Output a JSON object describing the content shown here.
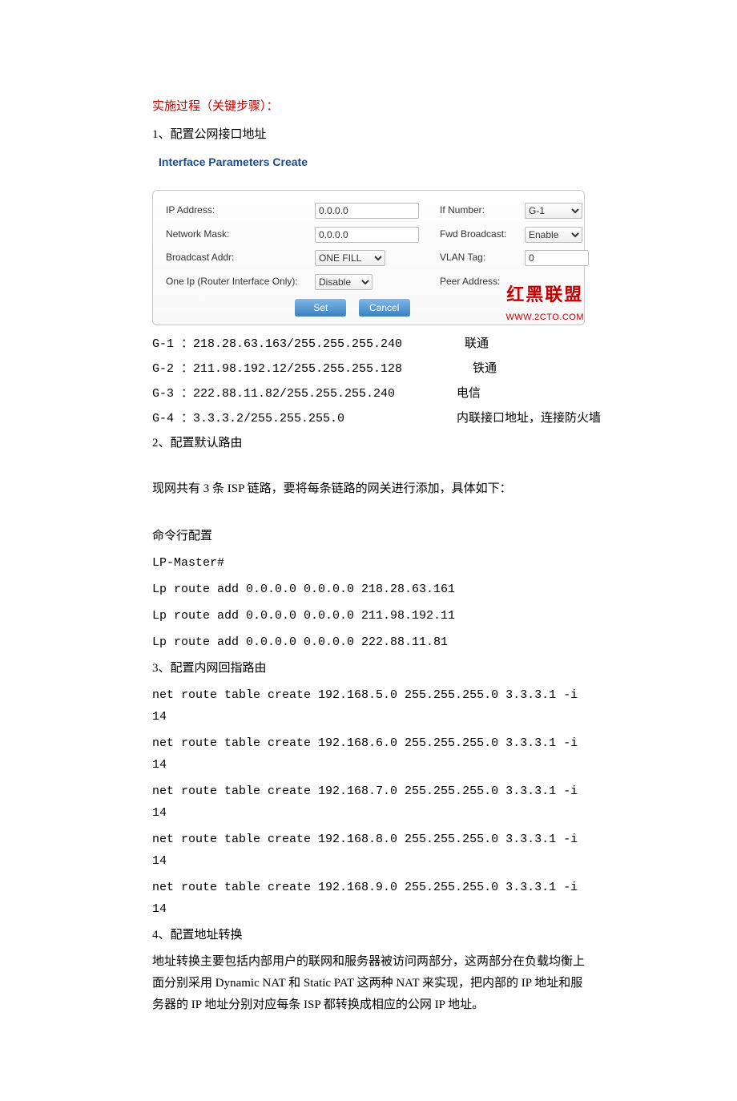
{
  "heading": "实施过程（关键步骤）：",
  "step1_title": "1、配置公网接口地址",
  "panel": {
    "title": "Interface Parameters Create",
    "labels": {
      "ip_address": "IP Address:",
      "network_mask": "Network Mask:",
      "broadcast_addr": "Broadcast Addr:",
      "one_ip": "One Ip (Router Interface Only):",
      "if_number": "If Number:",
      "fwd_broadcast": "Fwd Broadcast:",
      "vlan_tag": "VLAN Tag:",
      "peer_address": "Peer Address:"
    },
    "values": {
      "ip_address": "0.0.0.0",
      "network_mask": "0.0.0.0",
      "broadcast_addr": "ONE FILL",
      "one_ip": "Disable",
      "if_number": "G-1",
      "fwd_broadcast": "Enable",
      "vlan_tag": "0",
      "peer_address": ""
    },
    "buttons": {
      "set": "Set",
      "cancel": "Cancel"
    },
    "watermark_cn": "红黑联盟",
    "watermark_url": "WWW.2CTO.COM"
  },
  "interfaces": [
    {
      "left": "G-1 ：218.28.63.163/255.255.255.240",
      "right": "联通"
    },
    {
      "left": "G-2 ：211.98.192.12/255.255.255.128",
      "right": "铁通"
    },
    {
      "left": "G-3 ：222.88.11.82/255.255.255.240",
      "right": "电信"
    },
    {
      "left": "G-4 ：3.3.3.2/255.255.255.0",
      "right": "内联接口地址，连接防火墙"
    }
  ],
  "step2_title": "2、配置默认路由",
  "step2_desc": "现网共有 3 条 ISP 链路，要将每条链路的网关进行添加，具体如下：",
  "cli_header": "命令行配置",
  "cli_prompt": "LP-Master#",
  "cli_routes": [
    "Lp route add 0.0.0.0 0.0.0.0 218.28.63.161",
    "Lp route add 0.0.0.0 0.0.0.0 211.98.192.11",
    "Lp route add 0.0.0.0 0.0.0.0 222.88.11.81"
  ],
  "step3_title": "3、配置内网回指路由",
  "route_tables": [
    "net route table create 192.168.5.0 255.255.255.0 3.3.3.1 -i 14",
    "net route table create 192.168.6.0 255.255.255.0 3.3.3.1 -i 14",
    "net route table create 192.168.7.0 255.255.255.0 3.3.3.1 -i 14",
    "net route table create 192.168.8.0 255.255.255.0 3.3.3.1 -i 14",
    "net route table create 192.168.9.0 255.255.255.0 3.3.3.1 -i 14"
  ],
  "step4_title": "4、配置地址转换",
  "step4_desc": "地址转换主要包括内部用户的联网和服务器被访问两部分，这两部分在负载均衡上面分别采用 Dynamic NAT 和 Static PAT 这两种 NAT 来实现，把内部的 IP 地址和服务器的 IP 地址分别对应每条 ISP 都转换成相应的公网 IP 地址。"
}
